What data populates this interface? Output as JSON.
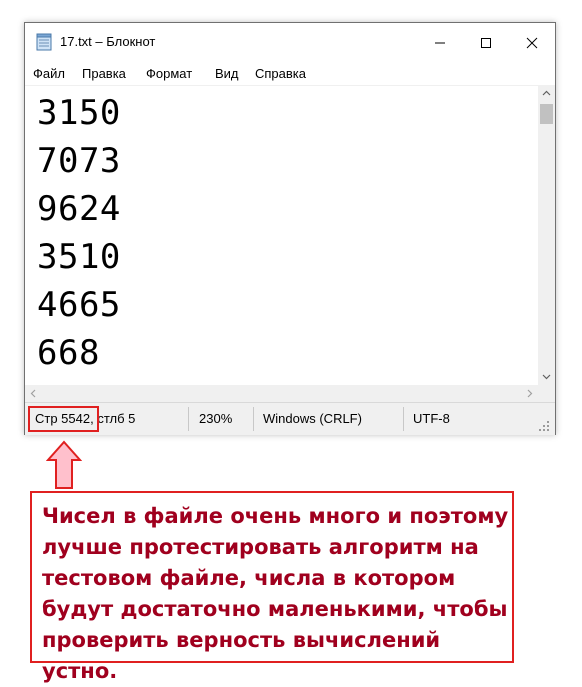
{
  "window": {
    "title": "17.txt – Блокнот",
    "controls": {
      "minimize_icon": "minimize-icon",
      "maximize_icon": "maximize-icon",
      "close_icon": "close-icon"
    }
  },
  "menu": [
    "Файл",
    "Правка",
    "Формат",
    "Вид",
    "Справка"
  ],
  "editor": {
    "lines": [
      "3150",
      "7073",
      "9624",
      "3510",
      "4665",
      "668"
    ]
  },
  "statusbar": {
    "position": "Стр 5542, стлб 5",
    "zoom": "230%",
    "line_endings": "Windows (CRLF)",
    "encoding": "UTF-8"
  },
  "annotation": {
    "color": "#e02020",
    "text_color": "#a0001e",
    "text": "Чисел в файле очень много и поэтому лучше протестировать алгоритм на тестовом файле, числа в котором будут достаточно маленькими, чтобы проверить верность вычислений устно."
  }
}
